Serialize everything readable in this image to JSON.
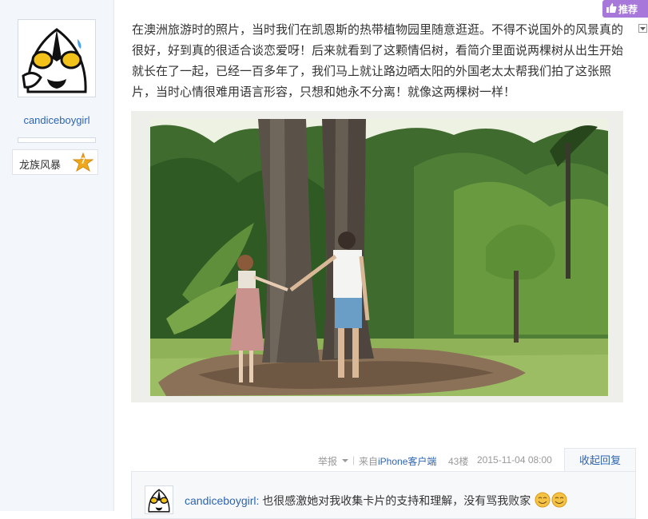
{
  "author": {
    "avatar": "ultraman-avatar",
    "username": "candiceboygirl",
    "badge_name": "龙族风暴",
    "badge_level": "7"
  },
  "recommend": {
    "label": "推荐",
    "icon": "thumbs-up-icon"
  },
  "post": {
    "lines": [
      "在澳洲旅游时的照片，当时我们在凯恩斯的热带植物园里随意逛逛。不得不说国外的风景真的",
      "很好，好到真的很适合谈恋爱呀！后来就看到了这颗情侣树，看简介里面说两棵树从出生开始",
      "就长在了一起，已经一百多年了，我们马上就让路边晒太阳的外国老太太帮我们拍了这张照",
      "片，当时心情很难用语言形容，只想和她永不分离！就像这两棵树一样！"
    ],
    "photo": "couple-holding-hands-between-two-trees"
  },
  "meta": {
    "report": "举报",
    "source_prefix": "来自",
    "source_link": "iPhone客户端",
    "floor": "43楼",
    "timestamp": "2015-11-04 08:00",
    "collapse_reply": "收起回复"
  },
  "reply": {
    "avatar": "ultraman-avatar",
    "user": "candiceboygirl:",
    "text": "也很感激她对我收集卡片的支持和理解，没有骂我败家",
    "emoji": [
      "smile-emoji",
      "smile-emoji"
    ]
  },
  "colors": {
    "link": "#2d64b3",
    "recommend_bg": "#a778d9",
    "sidebar_bg": "#f3f6fa",
    "meta_text": "#999999"
  }
}
